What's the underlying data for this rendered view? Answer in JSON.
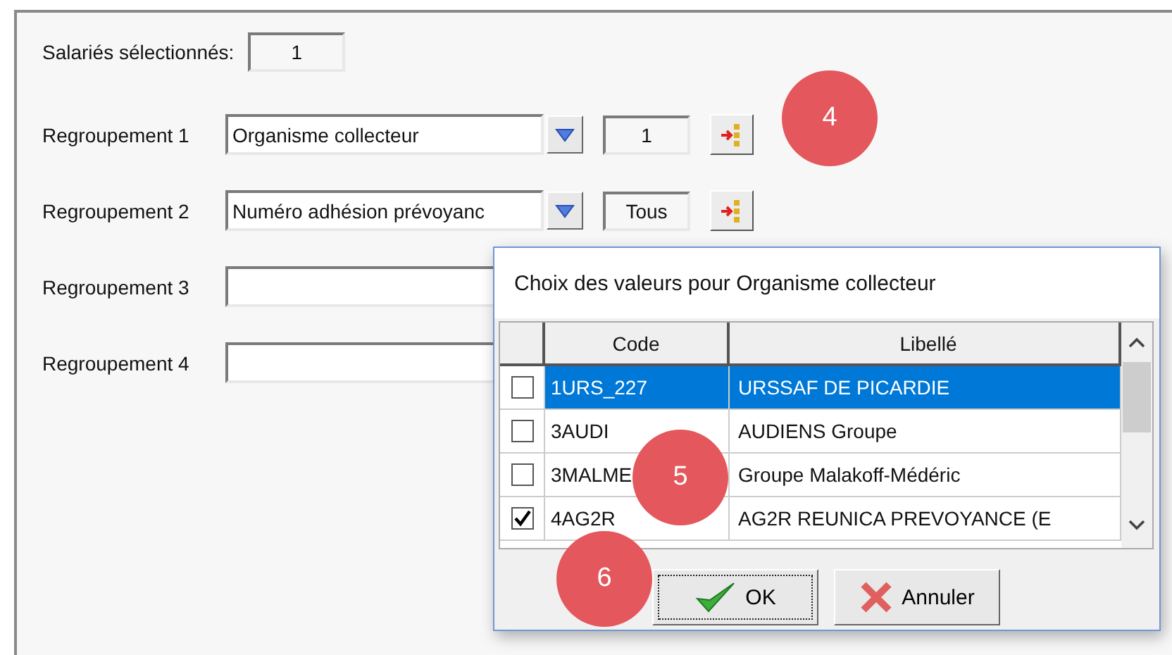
{
  "selected_employees": {
    "label": "Salariés sélectionnés:",
    "value": "1"
  },
  "groupings": [
    {
      "label": "Regroupement 1",
      "value": "Organisme collecteur",
      "count": "1"
    },
    {
      "label": "Regroupement 2",
      "value": "Numéro adhésion prévoyanc",
      "count": "Tous"
    },
    {
      "label": "Regroupement 3"
    },
    {
      "label": "Regroupement 4"
    }
  ],
  "dialog": {
    "title": "Choix des valeurs pour Organisme collecteur",
    "columns": [
      "Code",
      "Libellé"
    ],
    "rows": [
      {
        "code": "1URS_227",
        "label": "URSSAF DE PICARDIE",
        "checked": false,
        "selected": true
      },
      {
        "code": "3AUDI",
        "label": "AUDIENS Groupe",
        "checked": false,
        "selected": false
      },
      {
        "code": "3MALME",
        "label": "Groupe Malakoff-Médéric",
        "checked": false,
        "selected": false
      },
      {
        "code": "4AG2R",
        "label": "AG2R REUNICA PREVOYANCE (E",
        "checked": true,
        "selected": false
      }
    ],
    "ok": "OK",
    "cancel": "Annuler"
  },
  "step_badges": [
    "4",
    "5",
    "6"
  ]
}
